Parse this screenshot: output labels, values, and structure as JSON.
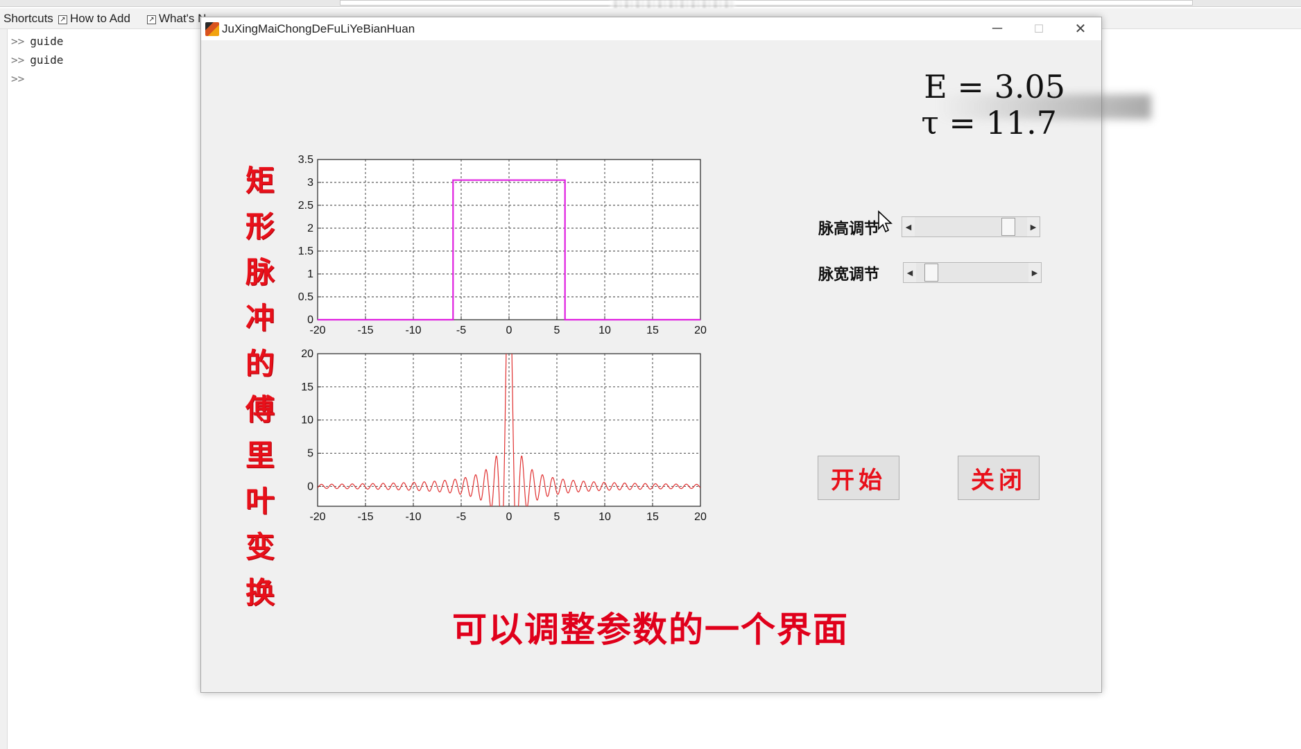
{
  "shortcuts_bar": {
    "items": [
      {
        "label": "Shortcuts"
      },
      {
        "label": "How to Add"
      },
      {
        "label": "What's N"
      }
    ]
  },
  "command_window": {
    "lines": [
      {
        "prompt": ">>",
        "text": "guide"
      },
      {
        "prompt": ">>",
        "text": "guide"
      },
      {
        "prompt": ">>",
        "text": ""
      }
    ]
  },
  "figure": {
    "title": "JuXingMaiChongDeFuLiYeBianHuan",
    "controls": {
      "minimize": "─",
      "maximize": "☐",
      "close": "✕"
    },
    "side_title_chars": [
      "矩",
      "形",
      "脉",
      "冲",
      "的",
      "傅",
      "里",
      "叶",
      "变",
      "换"
    ],
    "E_display": "E = 3.05",
    "tau_display": "τ = 11.7",
    "slider_height": {
      "label": "脉高调节",
      "value": 0.87
    },
    "slider_width": {
      "label": "脉宽调节",
      "value": 0.08
    },
    "start_button": "开始",
    "close_button": "关闭"
  },
  "caption": "可以调整参数的一个界面",
  "chart_data": [
    {
      "type": "line",
      "title": "",
      "xlabel": "",
      "ylabel": "",
      "xlim": [
        -20,
        20
      ],
      "ylim": [
        0,
        3.5
      ],
      "xticks": [
        "-20",
        "-15",
        "-10",
        "-5",
        "0",
        "5",
        "10",
        "15",
        "20"
      ],
      "yticks": [
        "0",
        "0.5",
        "1",
        "1.5",
        "2",
        "2.5",
        "3",
        "3.5"
      ],
      "grid": true,
      "color": "#e020e0",
      "series": [
        {
          "x": [
            -20,
            -5.85,
            -5.85,
            5.85,
            5.85,
            20
          ],
          "y": [
            0,
            0,
            3.05,
            3.05,
            0,
            0
          ]
        }
      ]
    },
    {
      "type": "line",
      "title": "",
      "xlabel": "",
      "ylabel": "",
      "xlim": [
        -20,
        20
      ],
      "ylim": [
        -3,
        20
      ],
      "xticks": [
        "-20",
        "-15",
        "-10",
        "-5",
        "0",
        "5",
        "10",
        "15",
        "20"
      ],
      "yticks": [
        "0",
        "5",
        "10",
        "15",
        "20"
      ],
      "grid": true,
      "color": "#e03030",
      "series": [
        {
          "function": "E*tau*sinc(omega*tau/2)",
          "E": 3.05,
          "tau": 11.7,
          "x_range": [
            -20,
            20
          ]
        }
      ]
    }
  ]
}
